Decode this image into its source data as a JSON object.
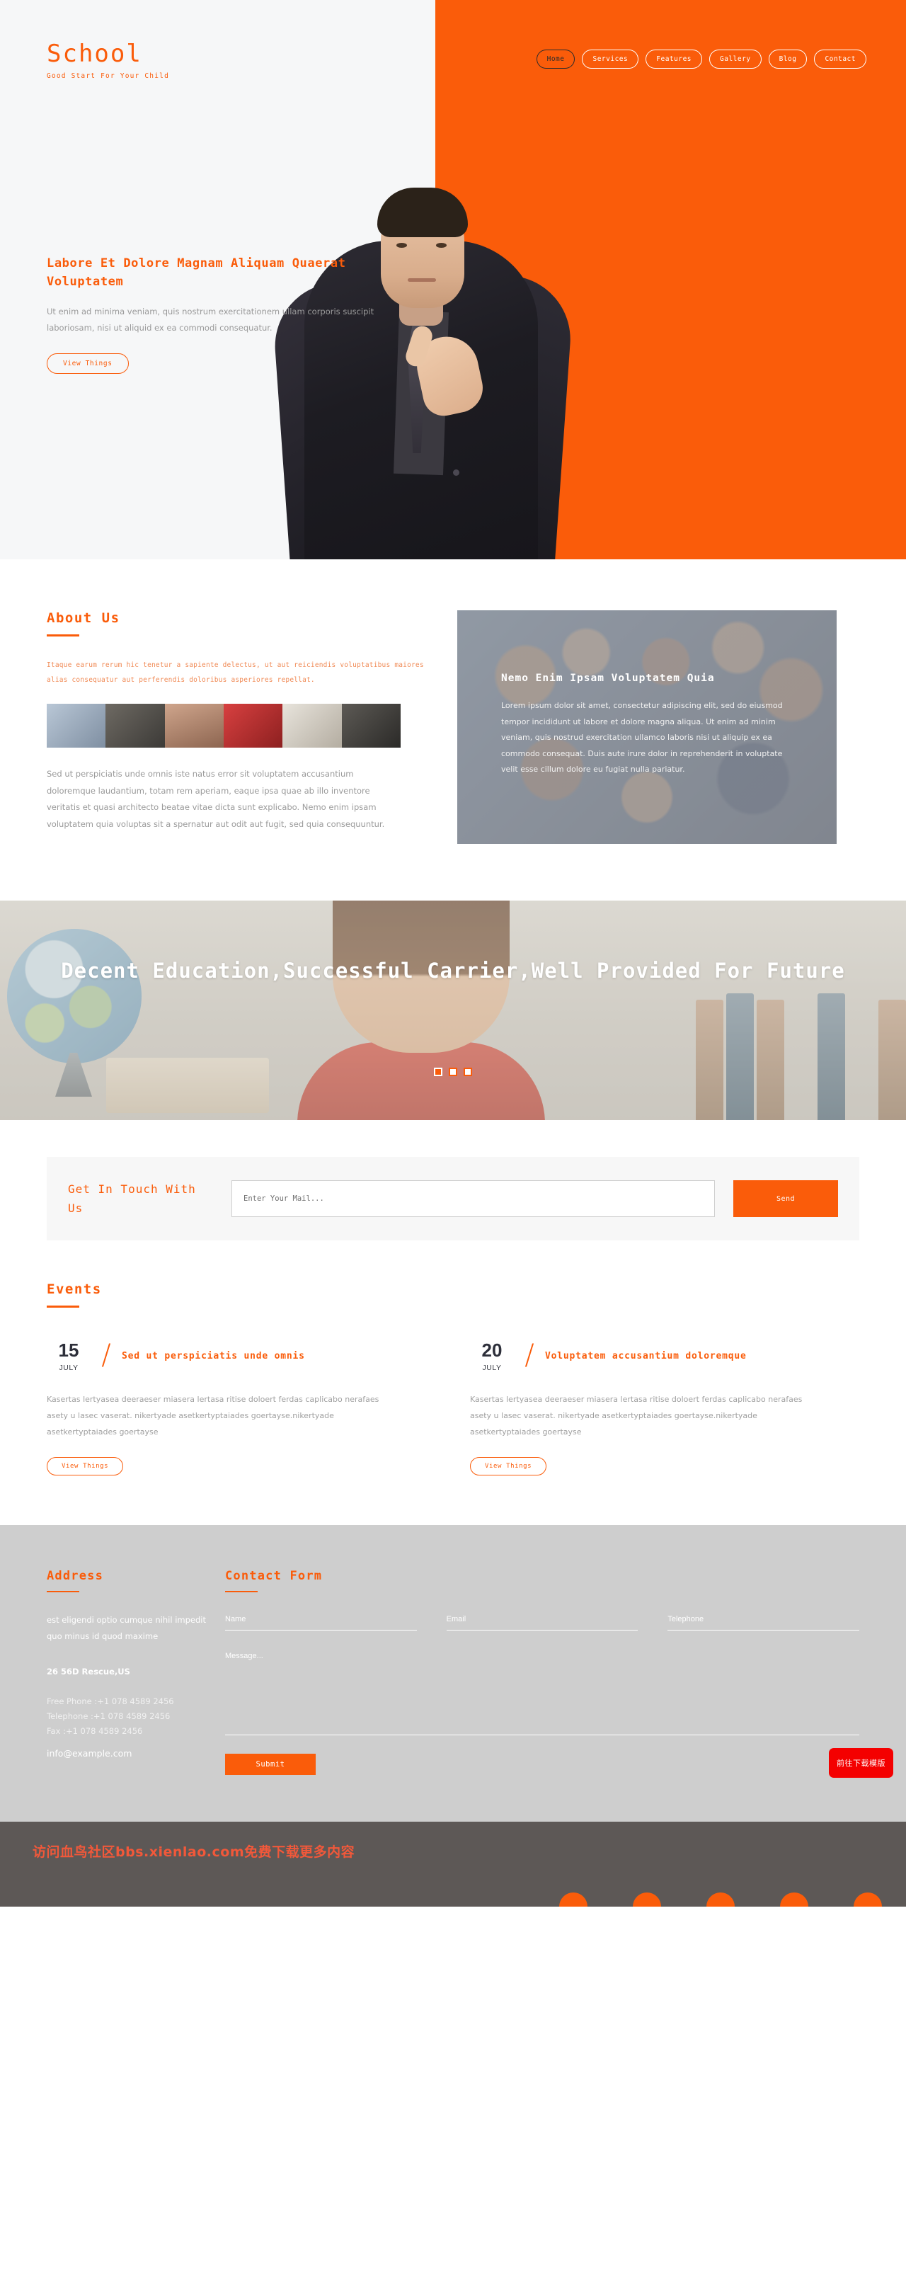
{
  "brand": {
    "title": "School",
    "tagline": "Good Start For Your Child"
  },
  "nav": {
    "items": [
      {
        "label": "Home",
        "active": true
      },
      {
        "label": "Services",
        "active": false
      },
      {
        "label": "Features",
        "active": false
      },
      {
        "label": "Gallery",
        "active": false
      },
      {
        "label": "Blog",
        "active": false
      },
      {
        "label": "Contact",
        "active": false
      }
    ]
  },
  "hero": {
    "title": "Labore Et Dolore Magnam Aliquam Quaerat Voluptatem",
    "text": "Ut enim ad minima veniam, quis nostrum exercitationem ullam corporis suscipit laboriosam, nisi ut aliquid ex ea commodi consequatur.",
    "button": "View Things"
  },
  "about": {
    "heading": "About Us",
    "lead": "Itaque earum rerum hic tenetur a sapiente delectus, ut aut reiciendis voluptatibus maiores alias consequatur aut perferendis doloribus asperiores repellat.",
    "body": "Sed ut perspiciatis unde omnis iste natus error sit voluptatem accusantium doloremque laudantium, totam rem aperiam, eaque ipsa quae ab illo inventore veritatis et quasi architecto beatae vitae dicta sunt explicabo. Nemo enim ipsam voluptatem quia voluptas sit a spernatur aut odit aut fugit, sed quia consequuntur.",
    "card": {
      "title": "Nemo Enim Ipsam Voluptatem Quia",
      "text": "Lorem ipsum dolor sit amet, consectetur adipiscing elit, sed do eiusmod tempor incididunt ut labore et dolore magna aliqua. Ut enim ad minim veniam, quis nostrud exercitation ullamco laboris nisi ut aliquip ex ea commodo consequat. Duis aute irure dolor in reprehenderit in voluptate velit esse cillum dolore eu fugiat nulla pariatur."
    }
  },
  "slider": {
    "title": "Decent Education,Successful Carrier,Well Provided For Future",
    "dots": [
      {
        "active": true
      },
      {
        "active": false
      },
      {
        "active": false
      }
    ]
  },
  "newsletter": {
    "title": "Get In Touch With Us",
    "placeholder": "Enter Your Mail...",
    "button": "Send"
  },
  "events": {
    "heading": "Events",
    "items": [
      {
        "day": "15",
        "month": "JULY",
        "title": "Sed ut perspiciatis unde omnis",
        "body": "Kasertas lertyasea deeraeser miasera lertasa ritise doloert ferdas caplicabo nerafaes asety u lasec vaserat. nikertyade asetkertyptaiades goertayse.nikertyade asetkertyptaiades goertayse",
        "button": "View Things"
      },
      {
        "day": "20",
        "month": "JULY",
        "title": "Voluptatem accusantium doloremque",
        "body": "Kasertas lertyasea deeraeser miasera lertasa ritise doloert ferdas caplicabo nerafaes asety u lasec vaserat. nikertyade asetkertyptaiades goertayse.nikertyade asetkertyptaiades goertayse",
        "button": "View Things"
      }
    ]
  },
  "footer": {
    "address": {
      "heading": "Address",
      "text": "est eligendi optio cumque nihil impedit quo minus id quod maxime",
      "street": "26 56D Rescue,US",
      "free_phone": "Free Phone :+1 078 4589 2456",
      "telephone": "Telephone :+1 078 4589 2456",
      "fax": "Fax :+1 078 4589 2456",
      "email": "info@example.com"
    },
    "form": {
      "heading": "Contact Form",
      "name_placeholder": "Name",
      "email_placeholder": "Email",
      "telephone_placeholder": "Telephone",
      "message_placeholder": "Message...",
      "submit": "Submit"
    },
    "float_button": "前往下载模版",
    "watermark": "访问血鸟社区bbs.xienlao.com免费下载更多内容"
  },
  "colors": {
    "accent": "#fa5c0a",
    "footer_bg": "#cecece",
    "bottom_bar": "#5d5856",
    "float_btn": "#f40000"
  }
}
